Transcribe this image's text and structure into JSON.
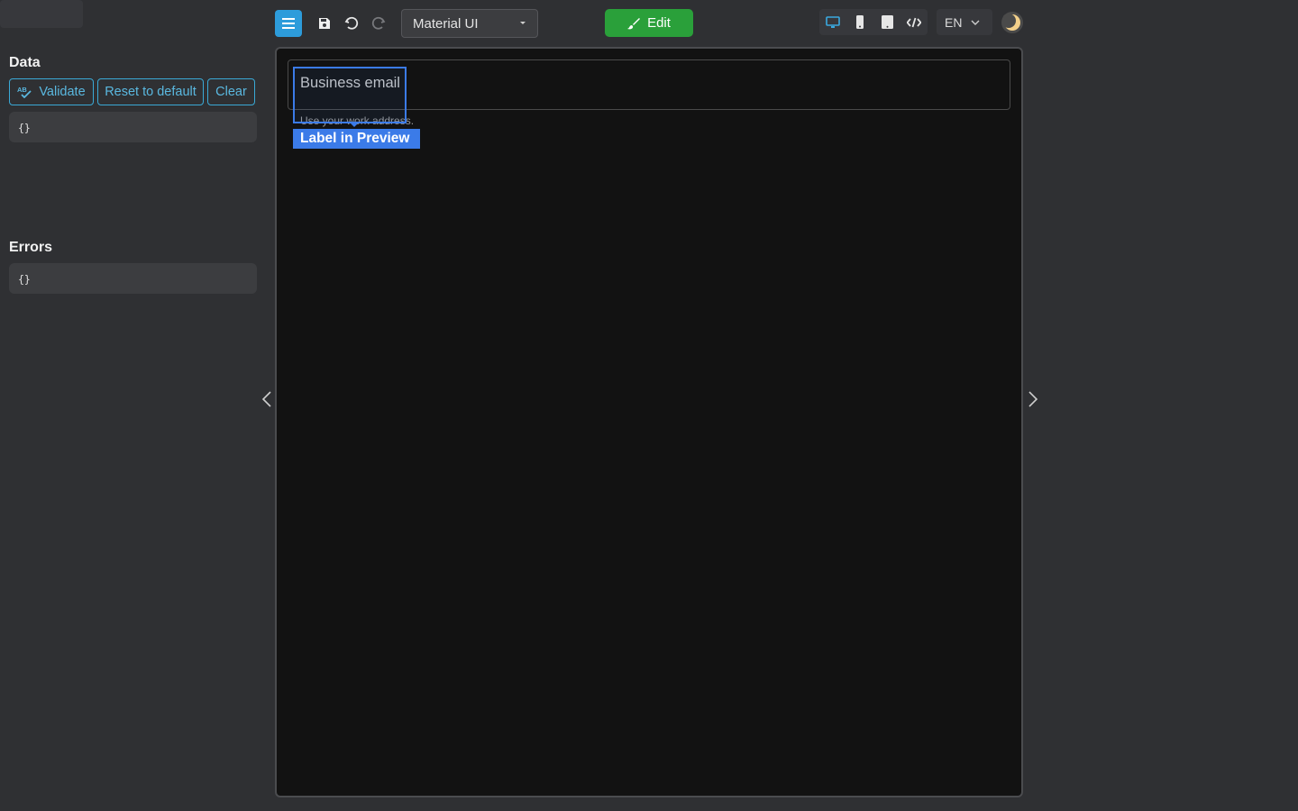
{
  "toolbar": {
    "menu_icon": "hamburger-icon",
    "save_icon": "save-icon",
    "undo_icon": "undo-icon",
    "redo_icon": "redo-icon",
    "theme_select_value": "Material UI",
    "edit_label": "Edit",
    "edit_icon": "paintbrush-icon",
    "devices": [
      "desktop-icon",
      "mobile-icon",
      "tablet-icon",
      "code-icon"
    ],
    "language": "EN",
    "dark_mode_icon": "moon-icon",
    "colors": {
      "menu_button": "#2d9cdb",
      "edit_button": "#2aa03a"
    }
  },
  "left_panel": {
    "data_title": "Data",
    "validate_label": "Validate",
    "reset_label": "Reset to default",
    "clear_label": "Clear",
    "data_json": "{}",
    "errors_title": "Errors",
    "errors_json": "{}"
  },
  "preview": {
    "field_label": "Business email",
    "helper_text": "Use your work address.",
    "overlay_tag": "Label in Preview",
    "colors": {
      "selection": "#3b7be8",
      "background": "#121212"
    }
  }
}
